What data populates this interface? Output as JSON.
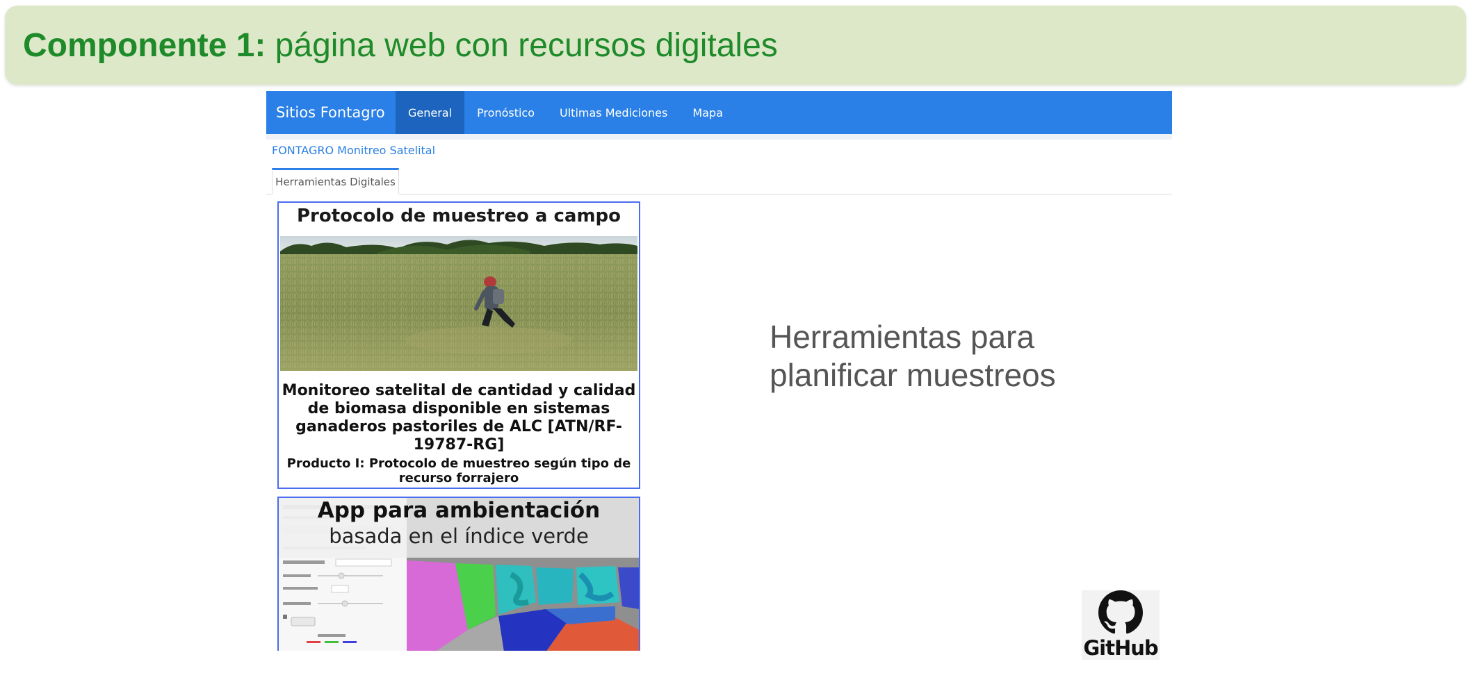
{
  "banner": {
    "label": "Componente 1:",
    "text": " página web con recursos digitales"
  },
  "site": {
    "brand": "Sitios Fontagro",
    "nav": [
      {
        "label": "General",
        "active": true
      },
      {
        "label": "Pronóstico",
        "active": false
      },
      {
        "label": "Ultimas Mediciones",
        "active": false
      },
      {
        "label": "Mapa",
        "active": false
      }
    ],
    "breadcrumb": "FONTAGRO Monitreo Satelital",
    "subtab": "Herramientas Digitales",
    "card1": {
      "title": "Protocolo de muestreo a campo",
      "description": "Monitoreo satelital de cantidad y calidad de biomasa disponible en sistemas ganaderos pastoriles de ALC [ATN/RF-19787-RG]",
      "product": "Producto I: Protocolo de muestreo según tipo de recurso forrajero"
    },
    "card2": {
      "title": "App para ambientación",
      "subtitle": "basada en el índice verde"
    }
  },
  "side_text": "Herramientas para planificar muestreos",
  "github": {
    "label": "GitHub",
    "icon": "github-octocat-icon"
  },
  "colors": {
    "banner_bg": "#dde8c9",
    "banner_text": "#1e8a2a",
    "navbar": "#2a80e6",
    "nav_active": "#1c64bd",
    "card_border": "#4a6cf0"
  }
}
